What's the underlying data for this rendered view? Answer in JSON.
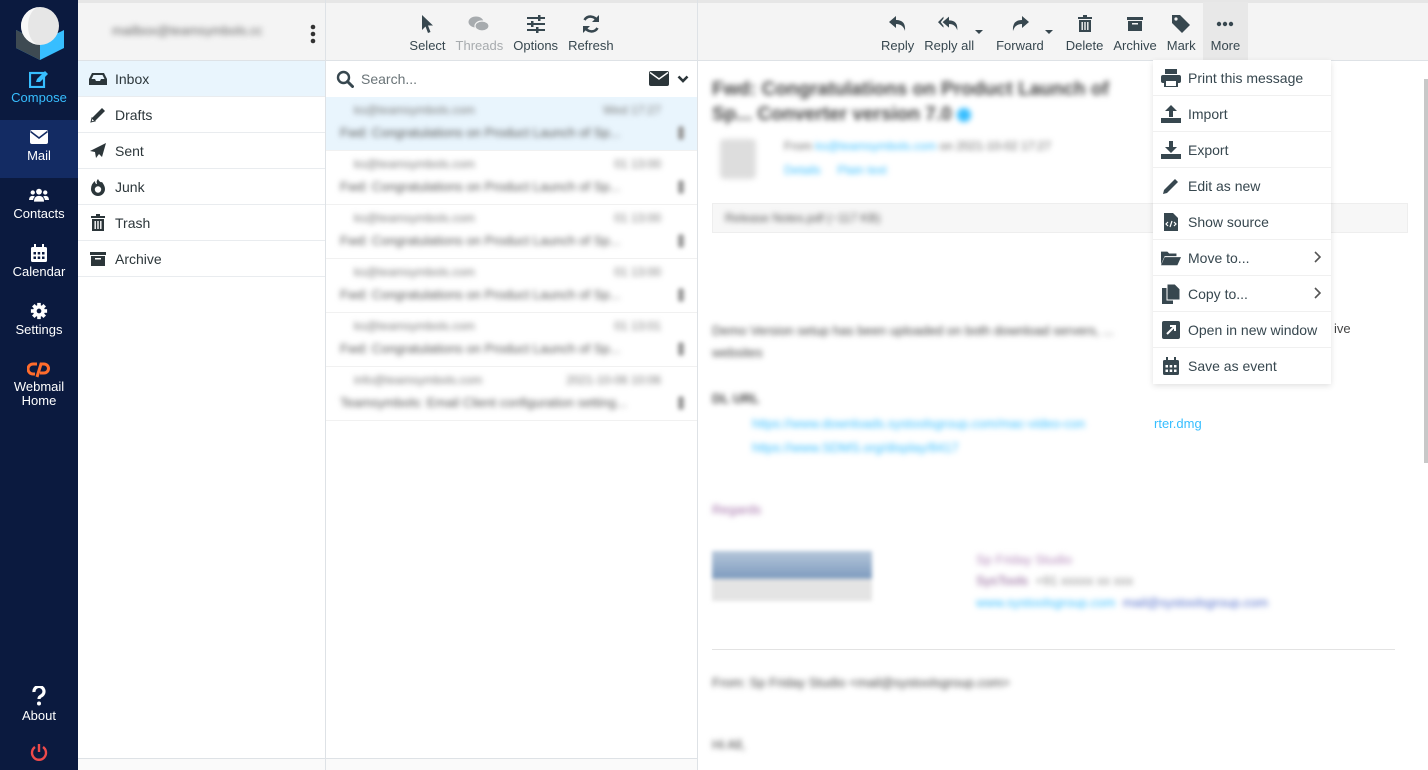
{
  "nav": {
    "compose": "Compose",
    "mail": "Mail",
    "contacts": "Contacts",
    "calendar": "Calendar",
    "settings": "Settings",
    "webmail_home": [
      "Webmail",
      "Home"
    ],
    "about": "About"
  },
  "account": {
    "email": "mailbox@teamsymbols.com",
    "redacted": true
  },
  "folders": [
    {
      "label": "Inbox",
      "icon": "inbox-icon",
      "selected": true
    },
    {
      "label": "Drafts",
      "icon": "pencil-icon"
    },
    {
      "label": "Sent",
      "icon": "paper-plane-icon"
    },
    {
      "label": "Junk",
      "icon": "fire-icon"
    },
    {
      "label": "Trash",
      "icon": "trash-icon"
    },
    {
      "label": "Archive",
      "icon": "archive-icon"
    }
  ],
  "list_toolbar": {
    "select": "Select",
    "threads": "Threads",
    "options": "Options",
    "refresh": "Refresh"
  },
  "search": {
    "placeholder": "Search..."
  },
  "messages": [
    {
      "from": "ks@teamsymbols.com",
      "date": "Wed 17:27",
      "subject": "Fwd: Congratulations on Product Launch of Sp...",
      "selected": true,
      "redacted": true
    },
    {
      "from": "ks@teamsymbols.com",
      "date": "01 13:00",
      "subject": "Fwd: Congratulations on Product Launch of Sp...",
      "redacted": true
    },
    {
      "from": "ks@teamsymbols.com",
      "date": "01 13:00",
      "subject": "Fwd: Congratulations on Product Launch of Sp...",
      "redacted": true
    },
    {
      "from": "ks@teamsymbols.com",
      "date": "01 13:00",
      "subject": "Fwd: Congratulations on Product Launch of Sp...",
      "redacted": true
    },
    {
      "from": "ks@teamsymbols.com",
      "date": "01 13:01",
      "subject": "Fwd: Congratulations on Product Launch of Sp...",
      "redacted": true
    },
    {
      "from": "info@teamsymbols.com",
      "date": "2021-10-06 10:06",
      "subject": "Teamsymbols: Email Client configuration setting...",
      "redacted": true
    }
  ],
  "reader_toolbar": {
    "reply": "Reply",
    "reply_all": "Reply all",
    "forward": "Forward",
    "delete": "Delete",
    "archive": "Archive",
    "mark": "Mark",
    "more": "More"
  },
  "message": {
    "subject": "Fwd: Congratulations on Product Launch of Sp... Converter version 7.0",
    "from_label": "From",
    "from_addr": "ks@teamsymbols.com",
    "date": "on 2021-10-02 17:27",
    "header_links": [
      "Details",
      "Plain text"
    ],
    "attachment": "Release Notes.pdf (~117 KB)",
    "body_line1": "Demo Version setup has been uploaded on both download servers, ...",
    "body_line1_visible_tail": "ive",
    "body_line2": "websites",
    "dl_heading": "DL URL",
    "link1": "https://www.downloads.systoolsgroup.com/mac-video-con",
    "link1_visible_tail": "rter.dmg",
    "link2": "https://www.SDMS.org/display/8417",
    "regards": "Regards",
    "sig_name": "Sp Friday Studio",
    "sig_company": "SysTools",
    "sig_phone": "+91 xxxxx xx xxx",
    "sig_web": "www.systoolsgroup.com",
    "sig_mail": "mail@systoolsgroup.com",
    "quoted_from": "From: Sp Friday Studio <mail@systoolsgroup.com>",
    "quoted_tail": "Hi All,",
    "redacted": true
  },
  "more_menu": [
    {
      "label": "Print this message",
      "icon": "print-icon"
    },
    {
      "label": "Import",
      "icon": "upload-icon"
    },
    {
      "label": "Export",
      "icon": "download-icon"
    },
    {
      "label": "Edit as new",
      "icon": "pencil-icon"
    },
    {
      "label": "Show source",
      "icon": "file-code-icon"
    },
    {
      "label": "Move to...",
      "icon": "folder-open-icon",
      "submenu": true
    },
    {
      "label": "Copy to...",
      "icon": "copy-icon",
      "submenu": true
    },
    {
      "label": "Open in new window",
      "icon": "external-window-icon"
    },
    {
      "label": "Save as event",
      "icon": "calendar-icon"
    }
  ],
  "colors": {
    "nav_bg": "#0b1a3f",
    "nav_selected": "#132b63",
    "accent": "#37beff",
    "selected_row": "#e9f5fd",
    "logout": "#ef4a4a",
    "cpanel": "#ff6c2c"
  }
}
